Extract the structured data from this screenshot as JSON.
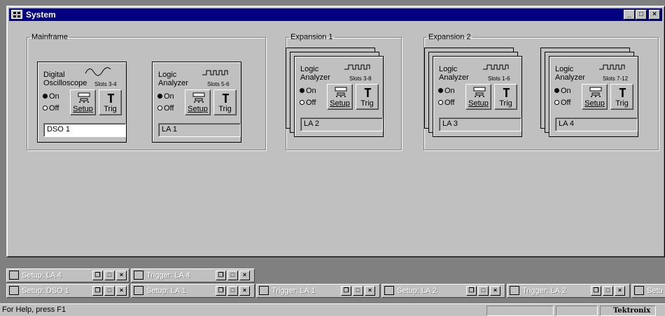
{
  "window": {
    "title": "System"
  },
  "mainframe": {
    "label": "Mainframe",
    "dso": {
      "name_line1": "Digital",
      "name_line2": "Oscilloscope",
      "slots": "Slots 3-4",
      "on": "On",
      "off": "Off",
      "setup": "Setup",
      "trig": "Trig",
      "field": "DSO 1"
    },
    "la": {
      "name_line1": "Logic",
      "name_line2": "Analyzer",
      "slots": "Slots 5-6",
      "on": "On",
      "off": "Off",
      "setup": "Setup",
      "trig": "Trig",
      "field": "LA 1"
    }
  },
  "expansion1": {
    "label": "Expansion 1",
    "la": {
      "name_line1": "Logic",
      "name_line2": "Analyzer",
      "slots": "Slots 3-8",
      "on": "On",
      "off": "Off",
      "setup": "Setup",
      "trig": "Trig",
      "field": "LA 2"
    }
  },
  "expansion2": {
    "label": "Expansion 2",
    "la_a": {
      "name_line1": "Logic",
      "name_line2": "Analyzer",
      "slots": "Slots 1-6",
      "on": "On",
      "off": "Off",
      "setup": "Setup",
      "trig": "Trig",
      "field": "LA 3"
    },
    "la_b": {
      "name_line1": "Logic",
      "name_line2": "Analyzer",
      "slots": "Slots 7-12",
      "on": "On",
      "off": "Off",
      "setup": "Setup",
      "trig": "Trig",
      "field": "LA 4"
    }
  },
  "minimized_row1": [
    "Setup: LA 4",
    "Trigger: LA 4"
  ],
  "minimized_row2": [
    "Setup: DSO 1",
    "Setup: LA 1",
    "Trigger: LA 1",
    "Setup: LA 2",
    "Trigger: LA 2",
    "Setu"
  ],
  "statusbar": {
    "help": "For Help, press F1",
    "brand": "Tektronix"
  },
  "icons": {
    "app": "grid-icon",
    "minimize": "minimize-icon",
    "maximize": "maximize-icon",
    "close": "close-icon",
    "restore": "restore-icon"
  },
  "colors": {
    "titlebar": "#000080",
    "face": "#c0c0c0",
    "workspace": "#808080"
  }
}
